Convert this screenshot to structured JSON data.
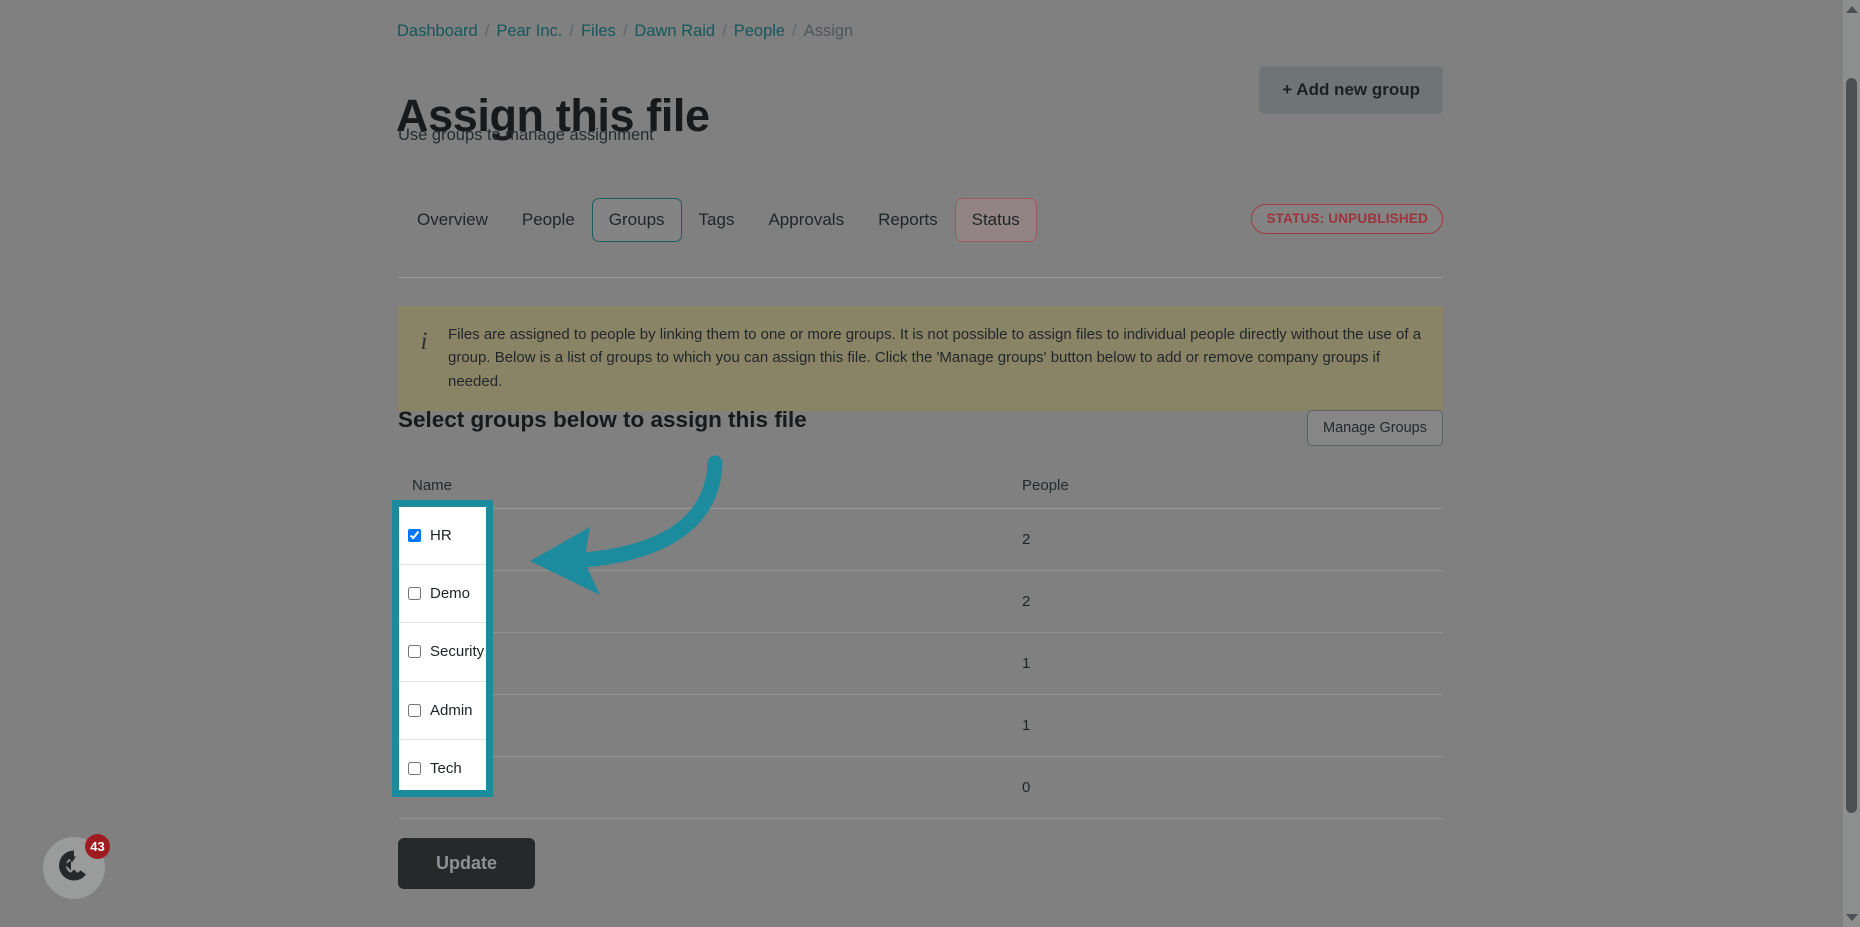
{
  "breadcrumb": {
    "items": [
      {
        "label": "Dashboard",
        "current": false
      },
      {
        "label": "Pear Inc.",
        "current": false
      },
      {
        "label": "Files",
        "current": false
      },
      {
        "label": "Dawn Raid",
        "current": false
      },
      {
        "label": "People",
        "current": false
      },
      {
        "label": "Assign",
        "current": true
      }
    ],
    "separator": "/"
  },
  "header": {
    "title": "Assign this file",
    "subtitle": "Use groups to manage assignment",
    "add_group_label": "+ Add new group"
  },
  "tabs": [
    {
      "label": "Overview",
      "state": "default"
    },
    {
      "label": "People",
      "state": "default"
    },
    {
      "label": "Groups",
      "state": "active"
    },
    {
      "label": "Tags",
      "state": "default"
    },
    {
      "label": "Approvals",
      "state": "default"
    },
    {
      "label": "Reports",
      "state": "default"
    },
    {
      "label": "Status",
      "state": "status"
    }
  ],
  "status_pill": {
    "label": "STATUS: UNPUBLISHED",
    "color": "#9c343c"
  },
  "info_banner": {
    "icon": "info-icon",
    "text": "Files are assigned to people by linking them to one or more groups. It is not possible to assign files to individual people directly without the use of a group. Below is a list of groups to which you can assign this file. Click the 'Manage groups' button below to add or remove company groups if needed.",
    "background": "#8a8467"
  },
  "section": {
    "heading": "Select groups below to assign this file",
    "manage_groups_label": "Manage Groups"
  },
  "table": {
    "columns": [
      "Name",
      "People"
    ],
    "rows": [
      {
        "name": "HR",
        "people": "2",
        "checked": true
      },
      {
        "name": "Demo",
        "people": "2",
        "checked": false
      },
      {
        "name": "Security",
        "people": "1",
        "checked": false
      },
      {
        "name": "Admin",
        "people": "1",
        "checked": false
      },
      {
        "name": "Tech",
        "people": "0",
        "checked": false
      }
    ]
  },
  "footer": {
    "update_label": "Update"
  },
  "chat_widget": {
    "badge_count": "43",
    "icon": "chat-bubble-icon",
    "badge_color": "#9e1b20"
  },
  "annotation": {
    "arrow_color": "#1d8b9e",
    "highlight_color": "#1d8b9e"
  }
}
